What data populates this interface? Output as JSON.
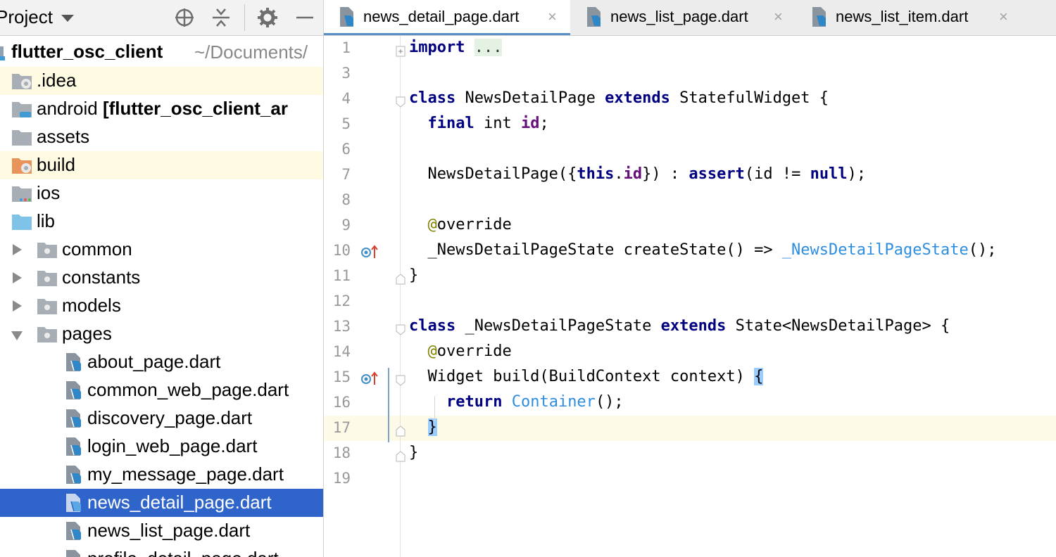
{
  "project_panel": {
    "title": "Project",
    "toolbar_icons": [
      "locate-icon",
      "collapse-all-icon",
      "gear-icon",
      "minimize-icon"
    ],
    "root": {
      "name": "flutter_osc_client",
      "path": "~/Documents/"
    },
    "items": [
      {
        "label": ".idea",
        "icon": "idea-folder-icon"
      },
      {
        "label": "android",
        "module": "[flutter_osc_client_ar",
        "icon": "android-module-folder-icon"
      },
      {
        "label": "assets",
        "icon": "folder-icon"
      },
      {
        "label": "build",
        "icon": "excluded-folder-icon"
      },
      {
        "label": "ios",
        "icon": "ios-folder-icon"
      },
      {
        "label": "lib",
        "icon": "source-folder-icon"
      },
      {
        "label": "common",
        "icon": "package-icon"
      },
      {
        "label": "constants",
        "icon": "package-icon"
      },
      {
        "label": "models",
        "icon": "package-icon"
      },
      {
        "label": "pages",
        "icon": "package-icon"
      },
      {
        "label": "about_page.dart",
        "icon": "dart-file-icon"
      },
      {
        "label": "common_web_page.dart",
        "icon": "dart-file-icon"
      },
      {
        "label": "discovery_page.dart",
        "icon": "dart-file-icon"
      },
      {
        "label": "login_web_page.dart",
        "icon": "dart-file-icon"
      },
      {
        "label": "my_message_page.dart",
        "icon": "dart-file-icon"
      },
      {
        "label": "news_detail_page.dart",
        "icon": "dart-file-icon",
        "selected": true
      },
      {
        "label": "news_list_page.dart",
        "icon": "dart-file-icon"
      },
      {
        "label": "profile_detail_page.dart",
        "icon": "dart-file-icon"
      }
    ]
  },
  "editor": {
    "tabs": [
      {
        "label": "news_detail_page.dart",
        "active": true,
        "close": "×"
      },
      {
        "label": "news_list_page.dart",
        "active": false,
        "close": "×"
      },
      {
        "label": "news_list_item.dart",
        "active": false,
        "close": "×"
      }
    ],
    "lines": [
      {
        "n": "1",
        "tokens": [
          {
            "t": "import",
            "c": "kw"
          },
          {
            "t": " "
          },
          {
            "t": "...",
            "c": "fold-dots"
          }
        ]
      },
      {
        "n": "3",
        "tokens": []
      },
      {
        "n": "4",
        "tokens": [
          {
            "t": "class",
            "c": "kw"
          },
          {
            "t": " NewsDetailPage "
          },
          {
            "t": "extends",
            "c": "kw"
          },
          {
            "t": " StatefulWidget {"
          }
        ]
      },
      {
        "n": "5",
        "tokens": [
          {
            "t": "  "
          },
          {
            "t": "final",
            "c": "kw"
          },
          {
            "t": " int "
          },
          {
            "t": "id",
            "c": "fld"
          },
          {
            "t": ";"
          }
        ]
      },
      {
        "n": "6",
        "tokens": []
      },
      {
        "n": "7",
        "tokens": [
          {
            "t": "  NewsDetailPage({"
          },
          {
            "t": "this",
            "c": "kw"
          },
          {
            "t": "."
          },
          {
            "t": "id",
            "c": "fld"
          },
          {
            "t": "}) : "
          },
          {
            "t": "assert",
            "c": "kw"
          },
          {
            "t": "(id != "
          },
          {
            "t": "null",
            "c": "kw"
          },
          {
            "t": ");"
          }
        ]
      },
      {
        "n": "8",
        "tokens": []
      },
      {
        "n": "9",
        "tokens": [
          {
            "t": "  "
          },
          {
            "t": "@",
            "c": "ann"
          },
          {
            "t": "override"
          }
        ]
      },
      {
        "n": "10",
        "tokens": [
          {
            "t": "  _NewsDetailPageState createState() => "
          },
          {
            "t": "_NewsDetailPageState",
            "c": "ref"
          },
          {
            "t": "();"
          }
        ]
      },
      {
        "n": "11",
        "tokens": [
          {
            "t": "}"
          }
        ]
      },
      {
        "n": "12",
        "tokens": []
      },
      {
        "n": "13",
        "tokens": [
          {
            "t": "class",
            "c": "kw"
          },
          {
            "t": " _NewsDetailPageState "
          },
          {
            "t": "extends",
            "c": "kw"
          },
          {
            "t": " State<NewsDetailPage> {"
          }
        ]
      },
      {
        "n": "14",
        "tokens": [
          {
            "t": "  "
          },
          {
            "t": "@",
            "c": "ann"
          },
          {
            "t": "override"
          }
        ]
      },
      {
        "n": "15",
        "tokens": [
          {
            "t": "  Widget build(BuildContext context) "
          },
          {
            "t": "{",
            "c": "brace-hl"
          }
        ]
      },
      {
        "n": "16",
        "tokens": [
          {
            "t": "    "
          },
          {
            "t": "return",
            "c": "kw"
          },
          {
            "t": " "
          },
          {
            "t": "Container",
            "c": "ref"
          },
          {
            "t": "();"
          }
        ]
      },
      {
        "n": "17",
        "tokens": [
          {
            "t": "  "
          },
          {
            "t": "}",
            "c": "brace-hl"
          }
        ],
        "current": true
      },
      {
        "n": "18",
        "tokens": [
          {
            "t": "}"
          }
        ]
      },
      {
        "n": "19",
        "tokens": []
      }
    ],
    "gutter_icons": [
      {
        "line": "10",
        "icon": "override-method-icon"
      },
      {
        "line": "15",
        "icon": "override-method-icon"
      }
    ],
    "colors": {
      "keyword": "#000080",
      "field": "#660e7a",
      "annotation": "#808000",
      "reference": "#2d8de0",
      "selection": "#2f65ca"
    }
  }
}
